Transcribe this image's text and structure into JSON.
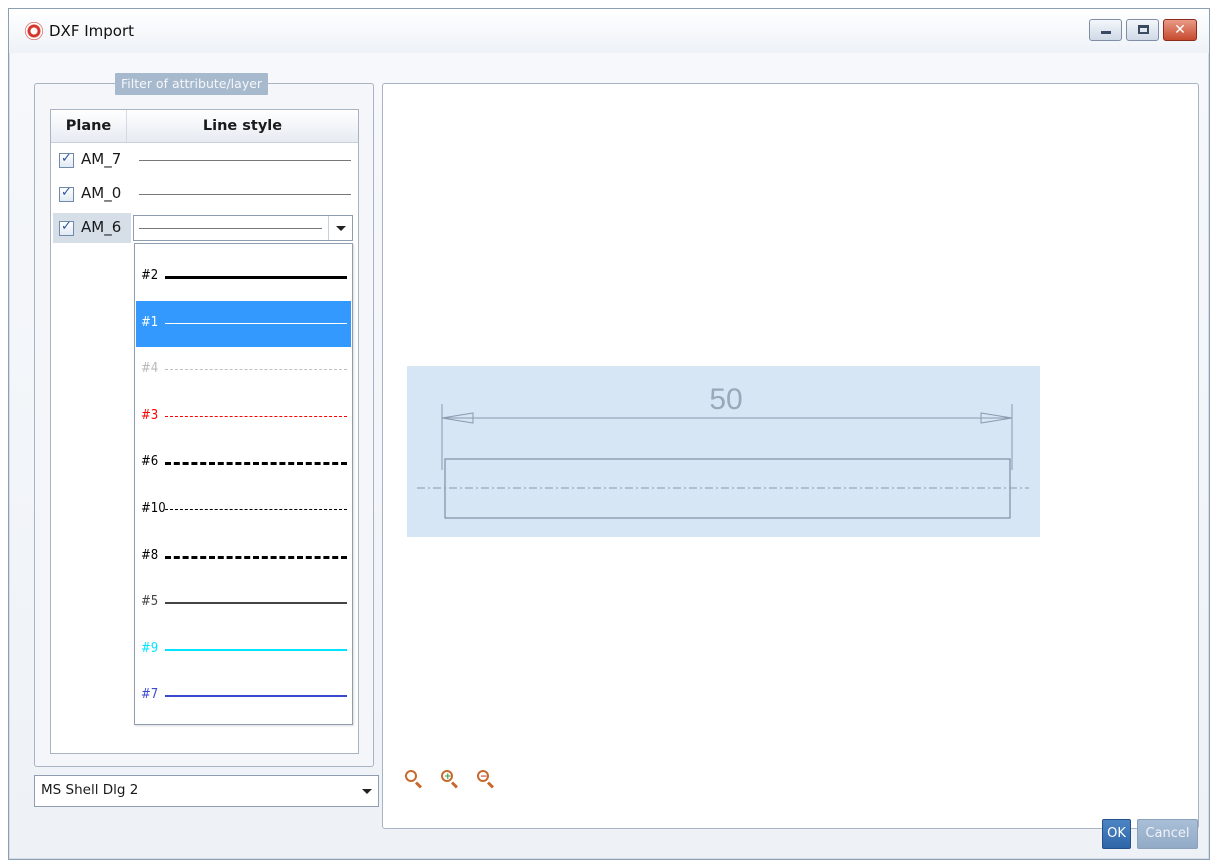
{
  "window": {
    "title": "DXF Import"
  },
  "filter": {
    "title": "Filter of attribute/layer",
    "columns": {
      "plane": "Plane",
      "line_style": "Line style"
    },
    "rows": [
      {
        "name": "AM_7",
        "checked": true
      },
      {
        "name": "AM_0",
        "checked": true
      },
      {
        "name": "AM_6",
        "checked": true
      }
    ]
  },
  "line_style_options": [
    {
      "label": "#2",
      "color": "#000000",
      "style": "solid-thick"
    },
    {
      "label": "#1",
      "color": "#ffffff",
      "style": "solid-thin",
      "selected": true
    },
    {
      "label": "#4",
      "color": "#c0c0c0",
      "style": "dashed"
    },
    {
      "label": "#3",
      "color": "#ff0000",
      "style": "dash-dot"
    },
    {
      "label": "#6",
      "color": "#000000",
      "style": "dash-dot-thick"
    },
    {
      "label": "#10",
      "color": "#000000",
      "style": "dash-dot-dot"
    },
    {
      "label": "#8",
      "color": "#000000",
      "style": "dash-dot-dot-thick"
    },
    {
      "label": "#5",
      "color": "#444444",
      "style": "solid"
    },
    {
      "label": "#9",
      "color": "#00e5ff",
      "style": "solid"
    },
    {
      "label": "#7",
      "color": "#3a4ad0",
      "style": "solid"
    }
  ],
  "preview": {
    "dimension_value": "50"
  },
  "zoom_icons": [
    "zoom-fit-icon",
    "zoom-in-icon",
    "zoom-out-icon"
  ],
  "font_select": {
    "value": "MS Shell Dlg 2"
  },
  "buttons": {
    "ok": "OK",
    "cancel": "Cancel"
  }
}
